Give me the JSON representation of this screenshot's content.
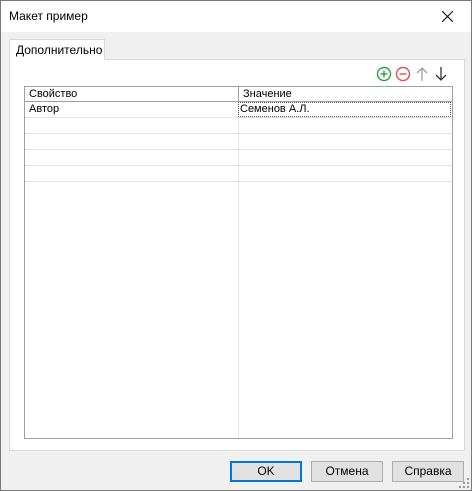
{
  "window": {
    "title": "Макет пример"
  },
  "tabs": [
    {
      "label": "Дополнительно"
    }
  ],
  "toolbar": {
    "add_icon": "plus-circle-icon",
    "remove_icon": "minus-circle-icon",
    "up_icon": "arrow-up-icon",
    "down_icon": "arrow-down-icon",
    "add_color": "#2ea043",
    "remove_color": "#d9534f"
  },
  "grid": {
    "columns": [
      "Свойство",
      "Значение"
    ],
    "rows": [
      {
        "property": "Автор",
        "value": "Семенов А.Л."
      }
    ]
  },
  "buttons": {
    "ok": "OK",
    "cancel": "Отмена",
    "help": "Справка"
  }
}
